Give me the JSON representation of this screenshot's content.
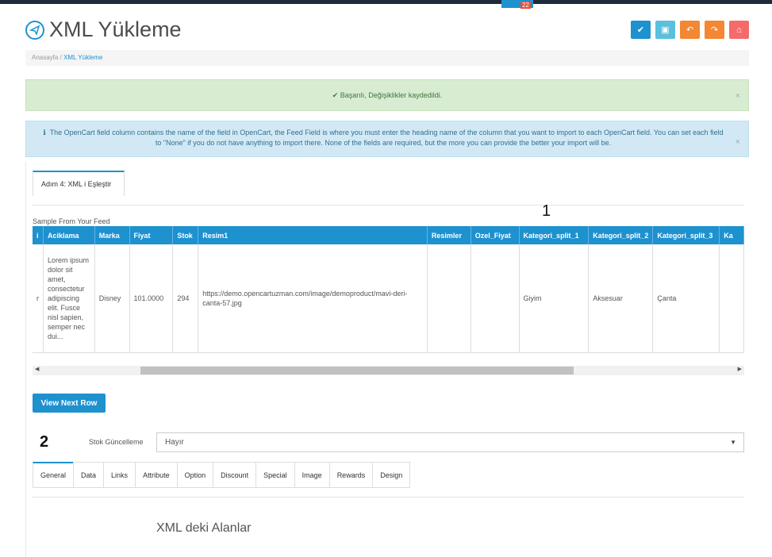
{
  "topbar": {
    "notif_count": "22"
  },
  "header": {
    "title": "XML Yükleme"
  },
  "actions": [
    {
      "icon": "check-icon",
      "color": "#1e91cf"
    },
    {
      "icon": "save-icon",
      "color": "#5bc0de"
    },
    {
      "icon": "reply-icon",
      "color": "#f38733"
    },
    {
      "icon": "forward-icon",
      "color": "#f38733"
    },
    {
      "icon": "home-icon",
      "color": "#f56b6b"
    }
  ],
  "breadcrumb": {
    "home": "Anasayfa",
    "separator": "/",
    "current": "XML Yükleme"
  },
  "alert_success": {
    "text": "Başarılı, Değişiklikler kaydedildi.",
    "close": "×"
  },
  "alert_info": {
    "text": "The OpenCart field column contains the name of the field in OpenCart, the Feed Field is where you must enter the heading name of the column that you want to import to each OpenCart field. You can set each field to \"None\" if you do not have anything to import there. None of the fields are required, but the more you can provide the better your import will be.",
    "close": "×"
  },
  "step_tab": {
    "label": "Adım 4: XML i Eşleştir"
  },
  "annotations": {
    "one": "1",
    "two": "2"
  },
  "sample": {
    "label": "Sample From Your Feed",
    "columns": [
      "i",
      "Aciklama",
      "Marka",
      "Fiyat",
      "Stok",
      "Resim1",
      "Resimler",
      "Ozel_Fiyat",
      "Kategori_split_1",
      "Kategori_split_2",
      "Kategori_split_3",
      "Ka"
    ],
    "row": [
      "r",
      "Lorem ipsum dolor sit amet, consectetur adipiscing elit. Fusce nisl sapien, semper nec dui...",
      "Disney",
      "101.0000",
      "294",
      "https://demo.opencartuzman.com/image/demoproduct/mavi-deri-canta-57.jpg",
      "",
      "",
      "Giyim",
      "Aksesuar",
      "Çanta",
      ""
    ]
  },
  "scroll": {
    "left": "◀",
    "right": "▶"
  },
  "next_button": {
    "label": "View Next Row"
  },
  "stok": {
    "label": "Stok Güncelleme",
    "value": "Hayır",
    "caret": "▼"
  },
  "tabs": [
    "General",
    "Data",
    "Links",
    "Attribute",
    "Option",
    "Discount",
    "Special",
    "Image",
    "Rewards",
    "Design"
  ],
  "section": {
    "title": "XML deki Alanlar"
  },
  "colors": {
    "primary": "#1e91cf",
    "success_bg": "#d8ecd2",
    "info_bg": "#d2e9f5"
  }
}
